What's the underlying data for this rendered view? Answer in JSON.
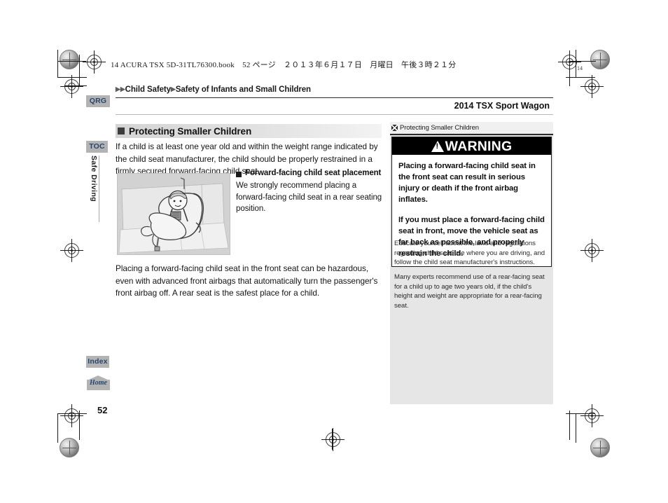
{
  "print_header": {
    "text": "14 ACURA TSX 5D-31TL76300.book　52 ページ　２０１３年６月１７日　月曜日　午後３時２１分",
    "edge_marker": "14"
  },
  "breadcrumb": {
    "arrow": "▶",
    "level1": "Child Safety",
    "level2": "Safety of Infants and Small Children"
  },
  "model_name": "2014 TSX Sport Wagon",
  "sidebar": {
    "qrg_label": "QRG",
    "toc_label": "TOC",
    "chapter_label": "Safe Driving",
    "index_label": "Index",
    "home_label": "Home"
  },
  "main": {
    "section_title": "Protecting Smaller Children",
    "intro_paragraph": "If a child is at least one year old and within the weight range indicated by the child seat manufacturer, the child should be properly restrained in a firmly secured forward-facing child seat.",
    "subsection_title": "Forward-facing child seat placement",
    "subsection_body": "We strongly recommend placing a forward-facing child seat in a rear seating position.",
    "bottom_paragraph": "Placing a forward-facing child seat in the front seat can be hazardous, even with advanced front airbags that automatically turn the passenger's front airbag off. A rear seat is the safest place for a child.",
    "figure_caption": "child-in-forward-facing-child-seat-on-rear-bench-seat"
  },
  "side_column": {
    "header_title": "Protecting Smaller Children",
    "warning_label": "WARNING",
    "warning_paragraph_1": "Placing a forward-facing child seat in the front seat can result in serious injury or death if the front airbag inflates.",
    "warning_paragraph_2": "If you must place a forward-facing child seat in front, move the vehicle seat as far back as possible, and properly restrain the child.",
    "note_1": "Educate yourself about the laws and regulations regarding child seat use where you are driving, and follow the child seat manufacturer's instructions.",
    "note_2": "Many experts recommend use of a rear-facing seat for a child up to age two years old, if the child's height and weight are appropriate for a rear-facing seat."
  },
  "page_number": "52",
  "colors": {
    "tab_background": "#b3b3b3",
    "tab_text": "#26456f",
    "section_head_gray": "#d4d4d4",
    "side_column_gray": "#e6e6e6",
    "warning_banner": "#000000"
  }
}
